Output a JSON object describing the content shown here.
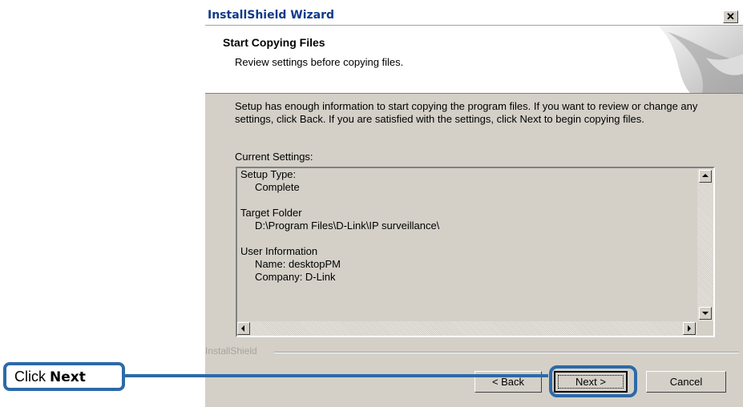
{
  "window": {
    "title": "InstallShield Wizard"
  },
  "header": {
    "title": "Start Copying Files",
    "subtitle": "Review settings before copying files."
  },
  "body": {
    "description": "Setup has enough information to start copying the program files.  If you want to review or change any settings, click Back.  If you are satisfied with the settings, click Next to begin copying files.",
    "current_settings_label": "Current Settings:",
    "settings_lines": [
      "Setup Type:",
      "     Complete",
      "",
      "Target Folder",
      "     D:\\Program Files\\D-Link\\IP surveillance\\",
      "",
      "User Information",
      "     Name: desktopPM",
      "     Company: D-Link"
    ]
  },
  "footer": {
    "brand": "InstallShield",
    "back_label": "< Back",
    "next_label": "Next >",
    "cancel_label": "Cancel"
  },
  "annotation": {
    "prefix": "Click",
    "emphasis": "Next",
    "color": "#2c6aa8"
  },
  "icons": [
    "close-icon",
    "scroll-up-arrow-icon",
    "scroll-down-arrow-icon",
    "scroll-left-arrow-icon",
    "scroll-right-arrow-icon"
  ]
}
